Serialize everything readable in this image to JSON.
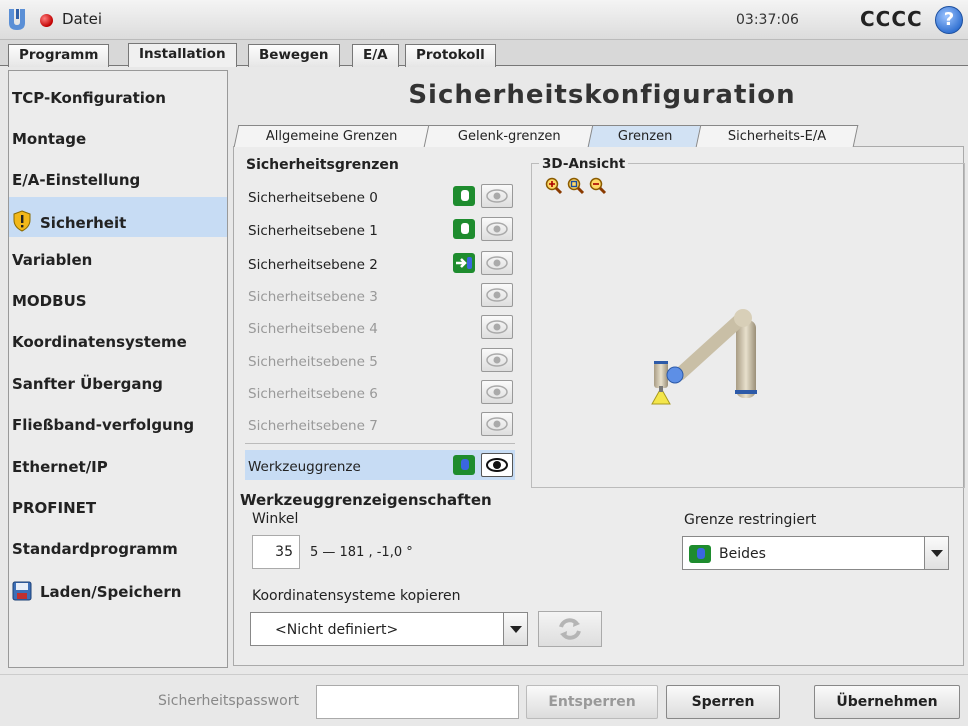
{
  "titlebar": {
    "file_menu": "Datei",
    "clock": "03:37:06",
    "robot_name": "CCCC",
    "help_glyph": "?"
  },
  "main_tabs": [
    {
      "label": "Programm",
      "active": false
    },
    {
      "label": "Installation",
      "active": true
    },
    {
      "label": "Bewegen",
      "active": false
    },
    {
      "label": "E/A",
      "active": false
    },
    {
      "label": "Protokoll",
      "active": false
    }
  ],
  "sidebar": {
    "items": [
      {
        "label": "TCP-Konfiguration"
      },
      {
        "label": "Montage"
      },
      {
        "label": "E/A-Einstellung"
      },
      {
        "label": "Sicherheit",
        "icon": "warning-shield-icon",
        "active": true
      },
      {
        "label": "Variablen"
      },
      {
        "label": "MODBUS"
      },
      {
        "label": "Koordinatensysteme"
      },
      {
        "label": "Sanfter Übergang"
      },
      {
        "label": "Fließband-verfolgung"
      },
      {
        "label": "Ethernet/IP"
      },
      {
        "label": "PROFINET"
      },
      {
        "label": "Standardprogramm"
      },
      {
        "label": "Laden/Speichern",
        "icon": "floppy-disk-icon"
      }
    ]
  },
  "page": {
    "title": "Sicherheitskonfiguration"
  },
  "sub_tabs": [
    {
      "label": "Allgemeine Grenzen",
      "active": false
    },
    {
      "label": "Gelenk-grenzen",
      "active": false
    },
    {
      "label": "Grenzen",
      "active": true
    },
    {
      "label": "Sicherheits-E/A",
      "active": false
    }
  ],
  "planes": {
    "heading": "Sicherheitsgrenzen",
    "rows": [
      {
        "label": "Sicherheitsebene 0",
        "enabled": true,
        "toggle": "normal"
      },
      {
        "label": "Sicherheitsebene 1",
        "enabled": true,
        "toggle": "normal"
      },
      {
        "label": "Sicherheitsebene 2",
        "enabled": true,
        "toggle": "trigger"
      },
      {
        "label": "Sicherheitsebene 3",
        "enabled": false
      },
      {
        "label": "Sicherheitsebene 4",
        "enabled": false
      },
      {
        "label": "Sicherheitsebene 5",
        "enabled": false
      },
      {
        "label": "Sicherheitsebene 6",
        "enabled": false
      },
      {
        "label": "Sicherheitsebene 7",
        "enabled": false
      }
    ],
    "tool_row": {
      "label": "Werkzeuggrenze",
      "enabled": true,
      "selected": true,
      "visible": true
    }
  },
  "view3d": {
    "title": "3D-Ansicht",
    "zoom_icons": [
      "zoom-in-icon",
      "zoom-reset-icon",
      "zoom-out-icon"
    ]
  },
  "tool_props": {
    "heading": "Werkzeuggrenzeigenschaften",
    "angle_label": "Winkel",
    "angle_value": "35",
    "angle_range": "5 — 181 , -1,0 °",
    "restrict_label": "Grenze restringiert",
    "restrict_value": "Beides",
    "copy_label": "Koordinatensysteme kopieren",
    "copy_value": "<Nicht definiert>"
  },
  "bottom": {
    "password_label": "Sicherheitspasswort",
    "password_value": "",
    "unlock_label": "Entsperren",
    "lock_label": "Sperren",
    "apply_label": "Übernehmen"
  },
  "colors": {
    "selection_blue": "#c7dcf4",
    "toggle_green": "#1e8c2e",
    "help_blue": "#2f6fd0"
  }
}
